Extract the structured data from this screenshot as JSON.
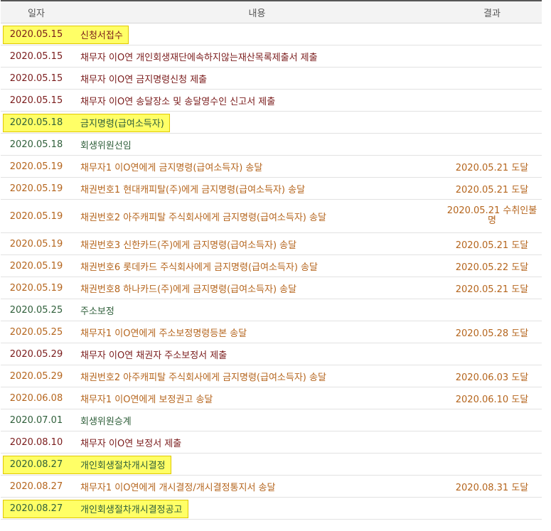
{
  "columns": {
    "date": "일자",
    "content": "내용",
    "result": "결과"
  },
  "colors": {
    "orange": "#b5651d",
    "maroon": "#7a1b1b",
    "green": "#2f5f3a",
    "highlight": "#ffff66"
  },
  "rows": [
    {
      "date": "2020.05.15",
      "content": "신청서접수",
      "result": "",
      "color": "maroon",
      "highlight": true
    },
    {
      "date": "2020.05.15",
      "content": "채무자 이O연 개인회생재단에속하지않는재산목록제출서 제출",
      "result": "",
      "color": "maroon"
    },
    {
      "date": "2020.05.15",
      "content": "채무자 이O연 금지명령신청 제출",
      "result": "",
      "color": "maroon"
    },
    {
      "date": "2020.05.15",
      "content": "채무자 이O연 송달장소 및 송달영수인 신고서 제출",
      "result": "",
      "color": "maroon"
    },
    {
      "date": "2020.05.18",
      "content": "금지명령(급여소득자)",
      "result": "",
      "color": "green",
      "highlight": true
    },
    {
      "date": "2020.05.18",
      "content": "회생위원선임",
      "result": "",
      "color": "green"
    },
    {
      "date": "2020.05.19",
      "content": "채무자1 이O연에게 금지명령(급여소득자) 송달",
      "result": "2020.05.21 도달",
      "color": "orange"
    },
    {
      "date": "2020.05.19",
      "content": "채권번호1 현대캐피탈(주)에게 금지명령(급여소득자) 송달",
      "result": "2020.05.21 도달",
      "color": "orange"
    },
    {
      "date": "2020.05.19",
      "content": "채권번호2 아주캐피탈 주식회사에게 금지명령(급여소득자) 송달",
      "result": "2020.05.21 수취인불명",
      "color": "orange",
      "tall": true
    },
    {
      "date": "2020.05.19",
      "content": "채권번호3 신한카드(주)에게 금지명령(급여소득자) 송달",
      "result": "2020.05.21 도달",
      "color": "orange"
    },
    {
      "date": "2020.05.19",
      "content": "채권번호6 롯데카드 주식회사에게 금지명령(급여소득자) 송달",
      "result": "2020.05.22 도달",
      "color": "orange"
    },
    {
      "date": "2020.05.19",
      "content": "채권번호8 하나카드(주)에게 금지명령(급여소득자) 송달",
      "result": "2020.05.21 도달",
      "color": "orange"
    },
    {
      "date": "2020.05.25",
      "content": "주소보정",
      "result": "",
      "color": "green"
    },
    {
      "date": "2020.05.25",
      "content": "채무자1 이O연에게 주소보정명령등본 송달",
      "result": "2020.05.28 도달",
      "color": "orange"
    },
    {
      "date": "2020.05.29",
      "content": "채무자 이O연 채권자 주소보정서 제출",
      "result": "",
      "color": "maroon"
    },
    {
      "date": "2020.05.29",
      "content": "채권번호2 아주캐피탈 주식회사에게 금지명령(급여소득자) 송달",
      "result": "2020.06.03 도달",
      "color": "orange"
    },
    {
      "date": "2020.06.08",
      "content": "채무자1 이O연에게 보정권고 송달",
      "result": "2020.06.10 도달",
      "color": "orange"
    },
    {
      "date": "2020.07.01",
      "content": "회생위원승계",
      "result": "",
      "color": "green"
    },
    {
      "date": "2020.08.10",
      "content": "채무자 이O연 보정서 제출",
      "result": "",
      "color": "maroon"
    },
    {
      "date": "2020.08.27",
      "content": "개인회생절차개시결정",
      "result": "",
      "color": "green",
      "highlight": true
    },
    {
      "date": "2020.08.27",
      "content": "채무자1 이O연에게 개시결정/개시결정통지서 송달",
      "result": "2020.08.31 도달",
      "color": "orange"
    },
    {
      "date": "2020.08.27",
      "content": "개인회생절차개시결정공고",
      "result": "",
      "color": "green",
      "highlight": true
    }
  ]
}
